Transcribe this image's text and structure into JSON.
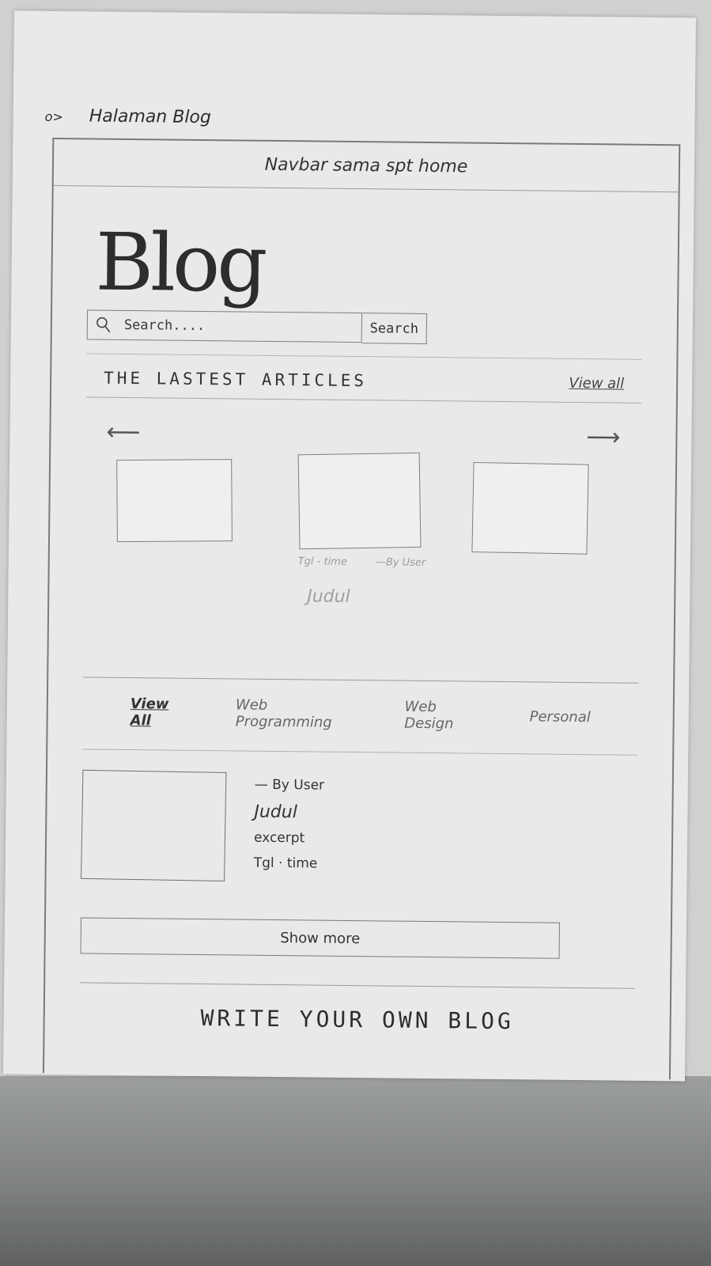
{
  "page_label": {
    "bullet": "o>",
    "text": "Halaman Blog"
  },
  "navbar": {
    "text": "Navbar sama spt home"
  },
  "hero": {
    "title": "Blog"
  },
  "search": {
    "placeholder": "Search....",
    "button_label": "Search"
  },
  "latest": {
    "title": "THE LASTEST ARTICLES",
    "view_all_label": "View all",
    "prev_arrow": "⟵",
    "next_arrow": "⟶",
    "card": {
      "date_time": "Tgl - time",
      "author": "—By User",
      "heading": "Judul"
    }
  },
  "categories": {
    "tabs": [
      "View All",
      "Web Programming",
      "Web Design",
      "Personal"
    ]
  },
  "post": {
    "author": "— By User",
    "title": "Judul",
    "excerpt": "excerpt",
    "date_time": "Tgl · time"
  },
  "show_more_label": "Show more",
  "cta": {
    "text": "WRITE YOUR OWN BLOG"
  }
}
